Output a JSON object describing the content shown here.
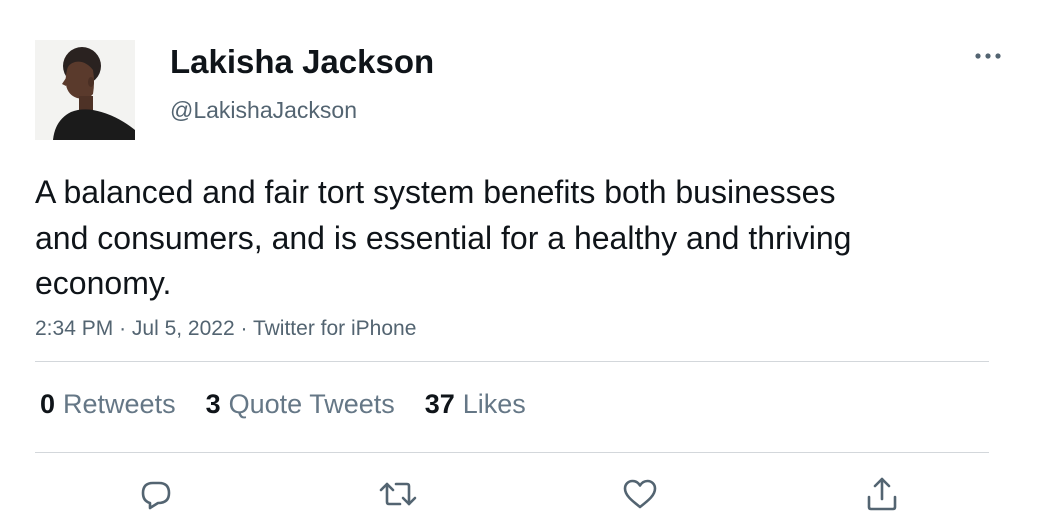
{
  "author": {
    "display_name": "Lakisha Jackson",
    "handle": "@LakishaJackson",
    "avatar_icon": "profile-photo"
  },
  "tweet": {
    "text": "A balanced and fair tort system benefits both businesses and consumers, and is essential for a healthy and thriving economy.",
    "time": "2:34 PM",
    "date": "Jul 5, 2022",
    "source": "Twitter for iPhone",
    "separator": "·"
  },
  "stats": {
    "retweets": {
      "count": "0",
      "label": "Retweets"
    },
    "quote_tweets": {
      "count": "3",
      "label": "Quote Tweets"
    },
    "likes": {
      "count": "37",
      "label": "Likes"
    }
  },
  "actions": {
    "reply_icon": "reply-icon",
    "retweet_icon": "retweet-icon",
    "like_icon": "heart-icon",
    "share_icon": "share-icon",
    "more_icon": "more-options-icon"
  },
  "colors": {
    "text_primary": "#0f1419",
    "text_secondary": "#536471",
    "icon": "#536471",
    "divider": "#d3d7db"
  }
}
